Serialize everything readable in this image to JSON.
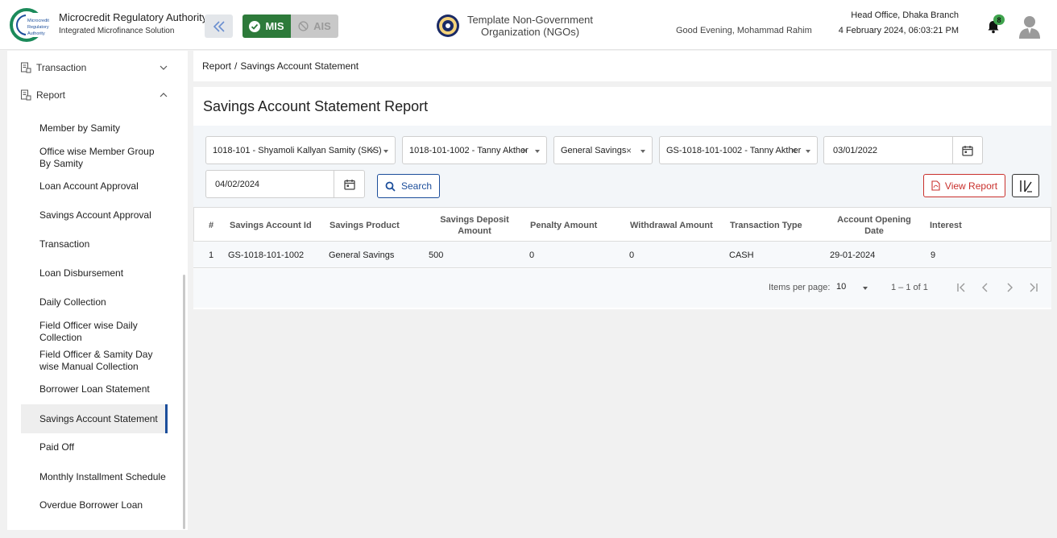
{
  "header": {
    "org_title": "Microcredit Regulatory Authority",
    "org_subtitle": "Integrated Microfinance Solution",
    "logo_text": [
      "Microcredit",
      "Regulatory",
      "Authority"
    ],
    "mis_label": "MIS",
    "ais_label": "AIS",
    "ngo_line1": "Template Non-Government",
    "ngo_line2": "Organization (NGOs)",
    "greeting": "Good Evening, Mohammad Rahim",
    "branch": "Head Office, Dhaka Branch",
    "datetime": "4 February 2024, 06:03:21 PM",
    "notification_count": "8",
    "colors": {
      "mis": "#2d7a3a",
      "ais": "#c8c8c8",
      "badge": "#3fa34d"
    }
  },
  "sidebar": {
    "groups": [
      {
        "label": "Transaction",
        "icon": "document-icon",
        "expanded": false
      },
      {
        "label": "Report",
        "icon": "document-icon",
        "expanded": true
      }
    ],
    "items": [
      "Member by Samity",
      "Office wise Member Group By Samity",
      "Loan Account Approval",
      "Savings Account Approval",
      "Transaction",
      "Loan Disbursement",
      "Daily Collection",
      "Field Officer wise Daily Collection",
      "Field Officer & Samity Day wise Manual Collection",
      "Borrower Loan Statement",
      "Savings Account Statement",
      "Paid Off",
      "Monthly Installment Schedule",
      "Overdue Borrower Loan"
    ],
    "active_item": "Savings Account Statement"
  },
  "breadcrumb": {
    "root": "Report",
    "separator": "/",
    "current": "Savings Account Statement"
  },
  "page": {
    "title": "Savings Account Statement Report"
  },
  "filters": {
    "samity": "1018-101 - Shyamoli Kallyan Samity (SKS)",
    "member": "1018-101-1002 - Tanny Akther",
    "product": "General Savings",
    "account": "GS-1018-101-1002 - Tanny Akther",
    "from_date": "03/01/2022",
    "to_date": "04/02/2024",
    "search_label": "Search",
    "view_report_label": "View Report"
  },
  "table": {
    "columns": [
      "#",
      "Savings Account Id",
      "Savings Product",
      "Savings Deposit Amount",
      "Penalty Amount",
      "Withdrawal Amount",
      "Transaction Type",
      "Account Opening Date",
      "Interest"
    ],
    "rows": [
      [
        "1",
        "GS-1018-101-1002",
        "General Savings",
        "500",
        "0",
        "0",
        "CASH",
        "29-01-2024",
        "9"
      ]
    ]
  },
  "paginator": {
    "items_per_page_label": "Items per page:",
    "items_per_page": "10",
    "range": "1 – 1 of 1"
  }
}
